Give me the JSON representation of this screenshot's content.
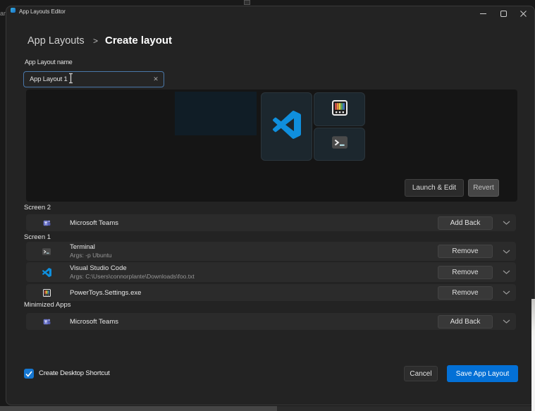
{
  "desktop": {
    "left_fragment": "an"
  },
  "titlebar": {
    "title": "App Layouts Editor"
  },
  "breadcrumb": {
    "root": "App Layouts",
    "sep": ">",
    "current": "Create layout"
  },
  "form": {
    "name_label": "App Layout name",
    "name_value": "App Layout 1",
    "clear_glyph": "✕"
  },
  "preview": {
    "launch_button": "Launch & Edit",
    "revert_button": "Revert"
  },
  "sections": [
    {
      "label": "Screen 2"
    },
    {
      "label": "Screen 1"
    },
    {
      "label": "Minimized Apps"
    }
  ],
  "rows": [
    {
      "section": 0,
      "icon": "teams-icon",
      "title": "Microsoft Teams",
      "args": "",
      "action": "Add Back"
    },
    {
      "section": 1,
      "icon": "terminal-icon",
      "title": "Terminal",
      "args": "Args: -p Ubuntu",
      "action": "Remove"
    },
    {
      "section": 1,
      "icon": "vscode-icon",
      "title": "Visual Studio Code",
      "args": "Args: C:\\Users\\connorplante\\Downloads\\foo.txt",
      "action": "Remove"
    },
    {
      "section": 1,
      "icon": "powertoys-icon",
      "title": "PowerToys.Settings.exe",
      "args": "",
      "action": "Remove"
    },
    {
      "section": 2,
      "icon": "teams-icon",
      "title": "Microsoft Teams",
      "args": "",
      "action": "Add Back"
    }
  ],
  "footer": {
    "checkbox_label": "Create Desktop Shortcut",
    "checkbox_checked": true,
    "cancel_button": "Cancel",
    "save_button": "Save App Layout"
  },
  "colors": {
    "accent_blue": "#0470d4",
    "checkbox_blue": "#1577d2",
    "input_focus_border": "#4a77a8",
    "vscode_blue": "#0f8fdd",
    "teams_purple": "#6b74c9"
  }
}
